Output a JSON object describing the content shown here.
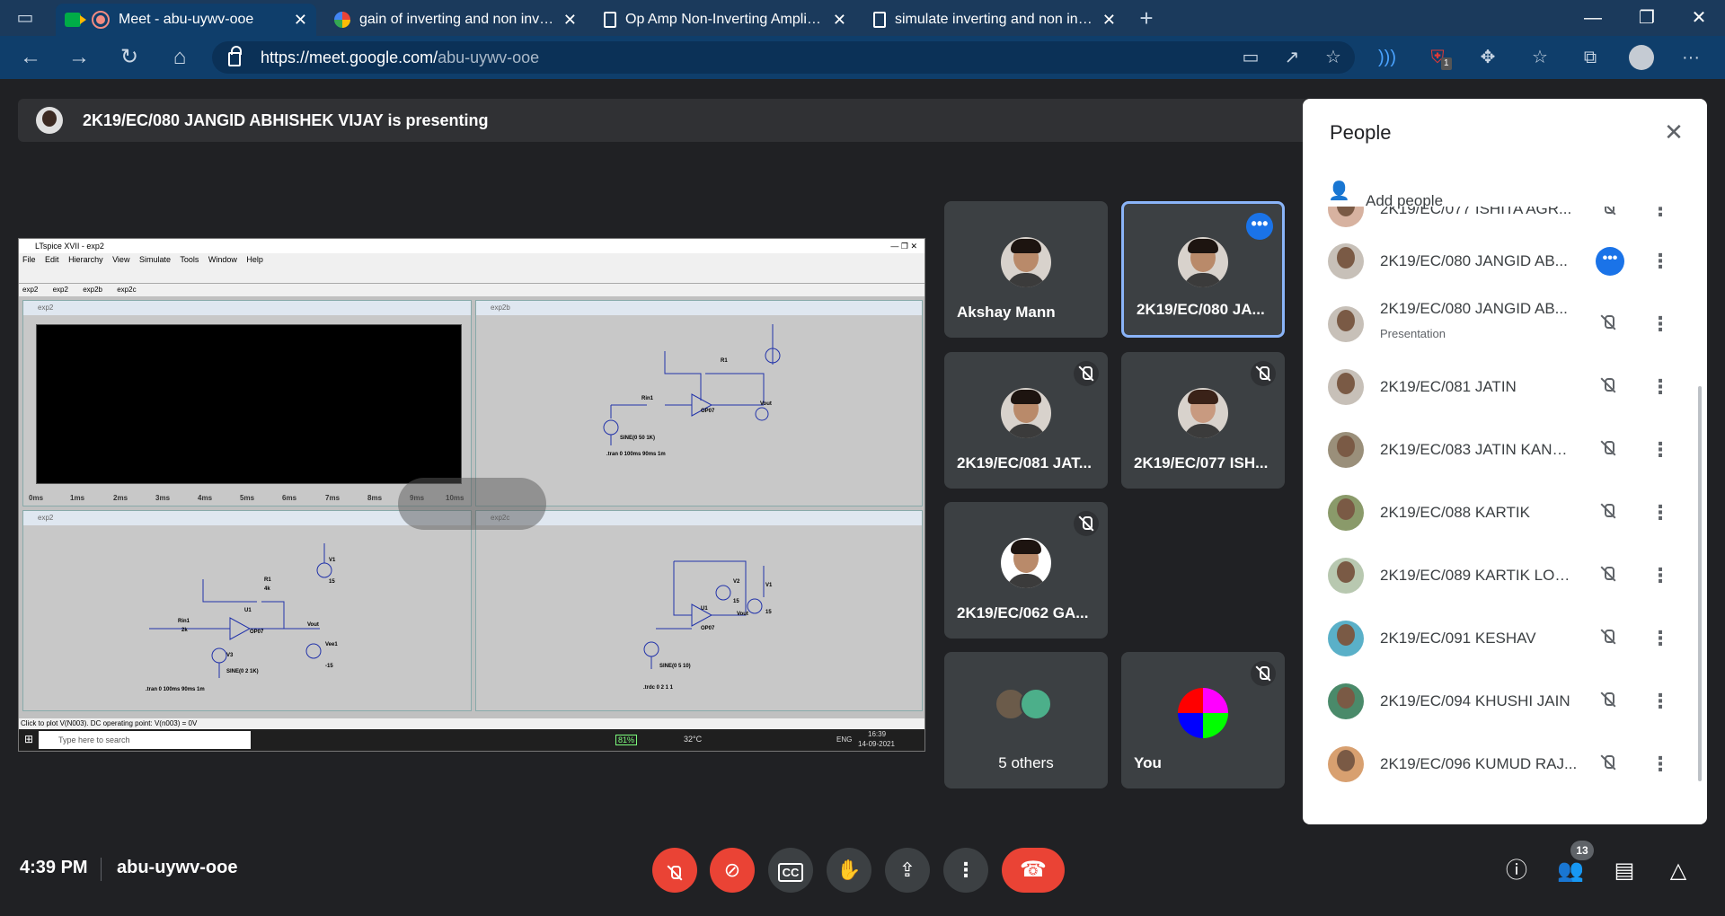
{
  "browser": {
    "tabs": [
      {
        "label": "Meet - abu-uywv-ooe",
        "icon": "google-meet-icon",
        "active": true
      },
      {
        "label": "gain of inverting and non inverting",
        "icon": "google-icon"
      },
      {
        "label": "Op Amp Non-Inverting Amplifier",
        "icon": "document-icon"
      },
      {
        "label": "simulate inverting and non inverting",
        "icon": "document-icon"
      }
    ],
    "new_tab": "+",
    "url_host": "https://meet.google.com/",
    "url_path": "abu-uywv-ooe",
    "extension_badge": "1"
  },
  "presenting": {
    "text": "2K19/EC/080 JANGID ABHISHEK VIJAY is presenting"
  },
  "shared_screen": {
    "app_title": "LTspice XVII - exp2",
    "menu": [
      "File",
      "Edit",
      "Hierarchy",
      "View",
      "Simulate",
      "Tools",
      "Window",
      "Help"
    ],
    "tabs": [
      "exp2",
      "exp2",
      "exp2b",
      "exp2c"
    ],
    "panes": [
      "exp2",
      "exp2b",
      "exp2",
      "exp2c"
    ],
    "x_ticks": [
      "0ms",
      "1ms",
      "2ms",
      "3ms",
      "4ms",
      "5ms",
      "6ms",
      "7ms",
      "8ms",
      "9ms",
      "10ms"
    ],
    "status": "Click to plot V(N003).  DC operating point: V(n003) = 0V",
    "taskbar_search": "Type here to search",
    "taskbar_battery": "81%",
    "taskbar_temp": "32°C",
    "taskbar_lang": "ENG",
    "taskbar_time": "16:39",
    "taskbar_date": "14-09-2021",
    "circuit_labels": {
      "r1": "R1",
      "r1v": "4k",
      "rin1": "Rin1",
      "rin1v": "2k",
      "u1": "U1",
      "op07": "OP07",
      "vout": "Vout",
      "v1": "V1",
      "v1v": "15",
      "vee1": "Vee1",
      "vee1v": "-15",
      "v3": "V3",
      "sine_a": "SINE(0 50 1K)",
      "tran_a": ".tran 0 100ms 90ms 1m",
      "sine_b": "SINE(0 2 1K)",
      "tran_b": ".tran 0 100ms 90ms 1m",
      "v2": "V2",
      "v2v": "15",
      "sine_c": "SINE(0 5 10)",
      "trdc_c": ".trdc 0 2 1 1"
    }
  },
  "tiles": [
    {
      "name": "Akshay Mann",
      "muted": false
    },
    {
      "name": "2K19/EC/080 JANGID ABHISHEK VIJAY",
      "display": "2K19/EC/080 JA...",
      "muted": false,
      "pinned": true
    },
    {
      "name": "2K19/EC/081 JATIN",
      "display": "2K19/EC/081 JAT...",
      "muted": true
    },
    {
      "name": "2K19/EC/077 ISHITA",
      "display": "2K19/EC/077 ISH...",
      "muted": true
    },
    {
      "name": "2K19/EC/062 GA",
      "display": "2K19/EC/062 GA...",
      "muted": true
    },
    {
      "name": "5 others"
    },
    {
      "name": "You",
      "muted": true
    }
  ],
  "people_panel": {
    "title": "People",
    "add_people": "Add people",
    "participants": [
      {
        "name": "2K19/EC/077 ISHITA AGR...",
        "muted": true
      },
      {
        "name": "2K19/EC/080 JANGID AB...",
        "more": true
      },
      {
        "name": "2K19/EC/080 JANGID AB...",
        "sub": "Presentation",
        "muted": true
      },
      {
        "name": "2K19/EC/081 JATIN",
        "muted": true
      },
      {
        "name": "2K19/EC/083 JATIN KANW...",
        "muted": true
      },
      {
        "name": "2K19/EC/088 KARTIK",
        "muted": true
      },
      {
        "name": "2K19/EC/089 KARTIK LOH...",
        "muted": true
      },
      {
        "name": "2K19/EC/091 KESHAV",
        "muted": true
      },
      {
        "name": "2K19/EC/094 KHUSHI JAIN",
        "muted": true
      },
      {
        "name": "2K19/EC/096 KUMUD RAJ...",
        "muted": true
      }
    ]
  },
  "bottom_bar": {
    "time": "4:39 PM",
    "meeting_code": "abu-uywv-ooe",
    "people_count": "13"
  },
  "colors": {
    "end_call": "#ea4335",
    "accent_blue": "#1a73e8",
    "tile_bg": "#3c4043",
    "page_bg": "#202124"
  }
}
